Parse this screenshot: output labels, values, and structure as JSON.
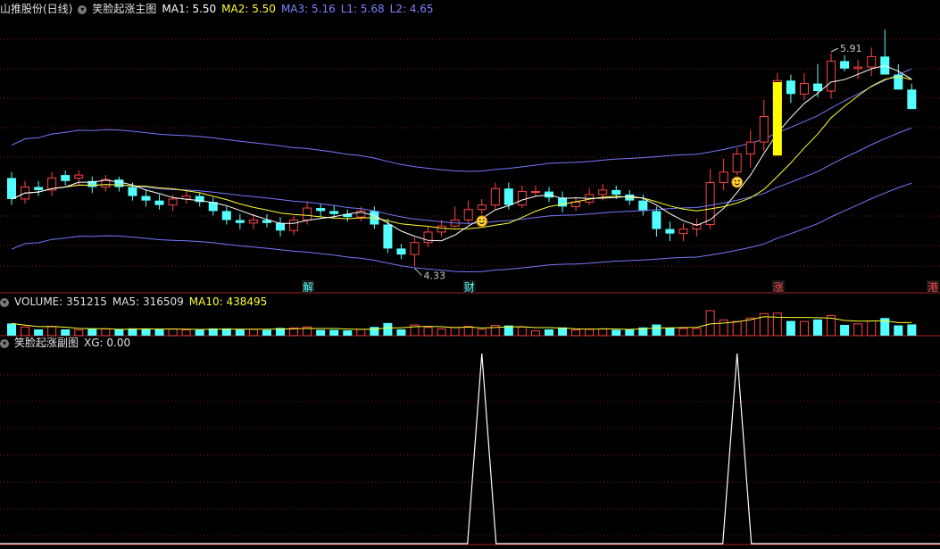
{
  "main_header": {
    "stock": "山推股份(日线)",
    "indicator": "笑脸起涨主图",
    "ma1": "MA1: 5.50",
    "ma2": "MA2: 5.50",
    "ma3": "MA3: 5.16",
    "l1": "L1: 5.68",
    "l2": "L2: 4.65"
  },
  "volume_header": {
    "volume": "VOLUME: 351215",
    "ma5": "MA5: 316509",
    "ma10": "MA10: 438495"
  },
  "sub_header": {
    "indicator": "笑脸起涨副图",
    "xg": "XG: 0.00"
  },
  "colors": {
    "up": "#ff4444",
    "down": "#54ffff",
    "ma1": "#ffffff",
    "ma2": "#ffff30",
    "ma3": "#7878ff",
    "grid": "#7a1818",
    "signal_bar": "#ffff00"
  },
  "chart_data": [
    {
      "type": "candlestick",
      "title": "笑脸起涨主图",
      "x": [
        0,
        1,
        2,
        3,
        4,
        5,
        6,
        7,
        8,
        9,
        10,
        11,
        12,
        13,
        14,
        15,
        16,
        17,
        18,
        19,
        20,
        21,
        22,
        23,
        24,
        25,
        26,
        27,
        28,
        29,
        30,
        31,
        32,
        33,
        34,
        35,
        36,
        37,
        38,
        39,
        40,
        41,
        42,
        43,
        44,
        45,
        46,
        47,
        48,
        49,
        50,
        51,
        52,
        53,
        54,
        55,
        56,
        57,
        58,
        59,
        60,
        61,
        62,
        63,
        64,
        65,
        66,
        67
      ],
      "open": [
        4.92,
        4.78,
        4.86,
        4.84,
        4.94,
        4.92,
        4.9,
        4.86,
        4.91,
        4.86,
        4.8,
        4.77,
        4.74,
        4.78,
        4.8,
        4.76,
        4.7,
        4.64,
        4.62,
        4.64,
        4.62,
        4.57,
        4.64,
        4.72,
        4.7,
        4.68,
        4.66,
        4.7,
        4.61,
        4.45,
        4.41,
        4.49,
        4.56,
        4.6,
        4.64,
        4.71,
        4.74,
        4.85,
        4.74,
        4.83,
        4.83,
        4.79,
        4.73,
        4.76,
        4.81,
        4.84,
        4.81,
        4.77,
        4.7,
        4.58,
        4.55,
        4.58,
        4.61,
        4.89,
        4.96,
        5.08,
        5.16,
        5.33,
        5.57,
        5.48,
        5.55,
        5.5,
        5.7,
        5.65,
        5.66,
        5.73,
        5.61,
        5.51
      ],
      "close": [
        4.78,
        4.86,
        4.84,
        4.92,
        4.9,
        4.94,
        4.86,
        4.91,
        4.86,
        4.8,
        4.77,
        4.74,
        4.78,
        4.8,
        4.76,
        4.7,
        4.64,
        4.62,
        4.64,
        4.62,
        4.57,
        4.64,
        4.72,
        4.7,
        4.68,
        4.66,
        4.7,
        4.61,
        4.45,
        4.41,
        4.49,
        4.56,
        4.6,
        4.64,
        4.71,
        4.74,
        4.85,
        4.74,
        4.83,
        4.83,
        4.79,
        4.73,
        4.76,
        4.81,
        4.84,
        4.81,
        4.77,
        4.7,
        4.58,
        4.55,
        4.58,
        4.61,
        4.89,
        4.96,
        5.08,
        5.16,
        5.33,
        5.57,
        5.48,
        5.55,
        5.5,
        5.7,
        5.65,
        5.66,
        5.73,
        5.61,
        5.51,
        5.38
      ],
      "high": [
        4.96,
        4.9,
        4.9,
        4.96,
        4.97,
        4.97,
        4.93,
        4.94,
        4.93,
        4.89,
        4.84,
        4.81,
        4.81,
        4.84,
        4.82,
        4.79,
        4.73,
        4.68,
        4.68,
        4.68,
        4.66,
        4.67,
        4.76,
        4.75,
        4.74,
        4.71,
        4.73,
        4.73,
        4.65,
        4.48,
        4.52,
        4.6,
        4.64,
        4.73,
        4.77,
        4.78,
        4.89,
        4.89,
        4.87,
        4.87,
        4.86,
        4.83,
        4.79,
        4.85,
        4.88,
        4.87,
        4.84,
        4.81,
        4.73,
        4.63,
        4.62,
        4.65,
        4.98,
        5.05,
        5.12,
        5.24,
        5.44,
        5.62,
        5.61,
        5.62,
        5.68,
        5.75,
        5.74,
        5.71,
        5.79,
        5.91,
        5.68,
        5.55
      ],
      "low": [
        4.74,
        4.75,
        4.8,
        4.8,
        4.87,
        4.88,
        4.82,
        4.83,
        4.83,
        4.77,
        4.73,
        4.71,
        4.7,
        4.75,
        4.73,
        4.67,
        4.61,
        4.58,
        4.58,
        4.59,
        4.53,
        4.54,
        4.61,
        4.66,
        4.65,
        4.63,
        4.63,
        4.58,
        4.42,
        4.38,
        4.33,
        4.46,
        4.53,
        4.59,
        4.61,
        4.68,
        4.71,
        4.71,
        4.72,
        4.8,
        4.76,
        4.69,
        4.7,
        4.74,
        4.77,
        4.78,
        4.74,
        4.67,
        4.53,
        4.5,
        4.5,
        4.53,
        4.58,
        4.84,
        4.94,
        4.99,
        5.1,
        5.27,
        5.42,
        5.44,
        5.46,
        5.45,
        5.63,
        5.58,
        5.6,
        5.66,
        5.58,
        5.43
      ],
      "annotations": [
        {
          "label": "5.91",
          "x": 61
        },
        {
          "label": "4.33",
          "x": 30
        }
      ],
      "signal_bar_x": 57,
      "smiley_x": [
        35,
        54
      ],
      "ylim": [
        4.25,
        6.0
      ]
    },
    {
      "type": "bar",
      "title": "VOLUME",
      "ylim": [
        0,
        1200000
      ]
    },
    {
      "type": "line",
      "title": "笑脸起涨副图",
      "series": [
        {
          "name": "XG",
          "peaks_at": [
            35,
            54
          ]
        }
      ],
      "ylim": [
        0,
        1
      ]
    }
  ],
  "bottom_labels": [
    {
      "text": "解",
      "x": 22,
      "color": "#54ffff"
    },
    {
      "text": "财",
      "x": 34,
      "color": "#54ffff"
    },
    {
      "text": "涨",
      "x": 57,
      "color": "#ff4444"
    },
    {
      "text": "港",
      "x": 70,
      "color": "#ff4444"
    }
  ]
}
